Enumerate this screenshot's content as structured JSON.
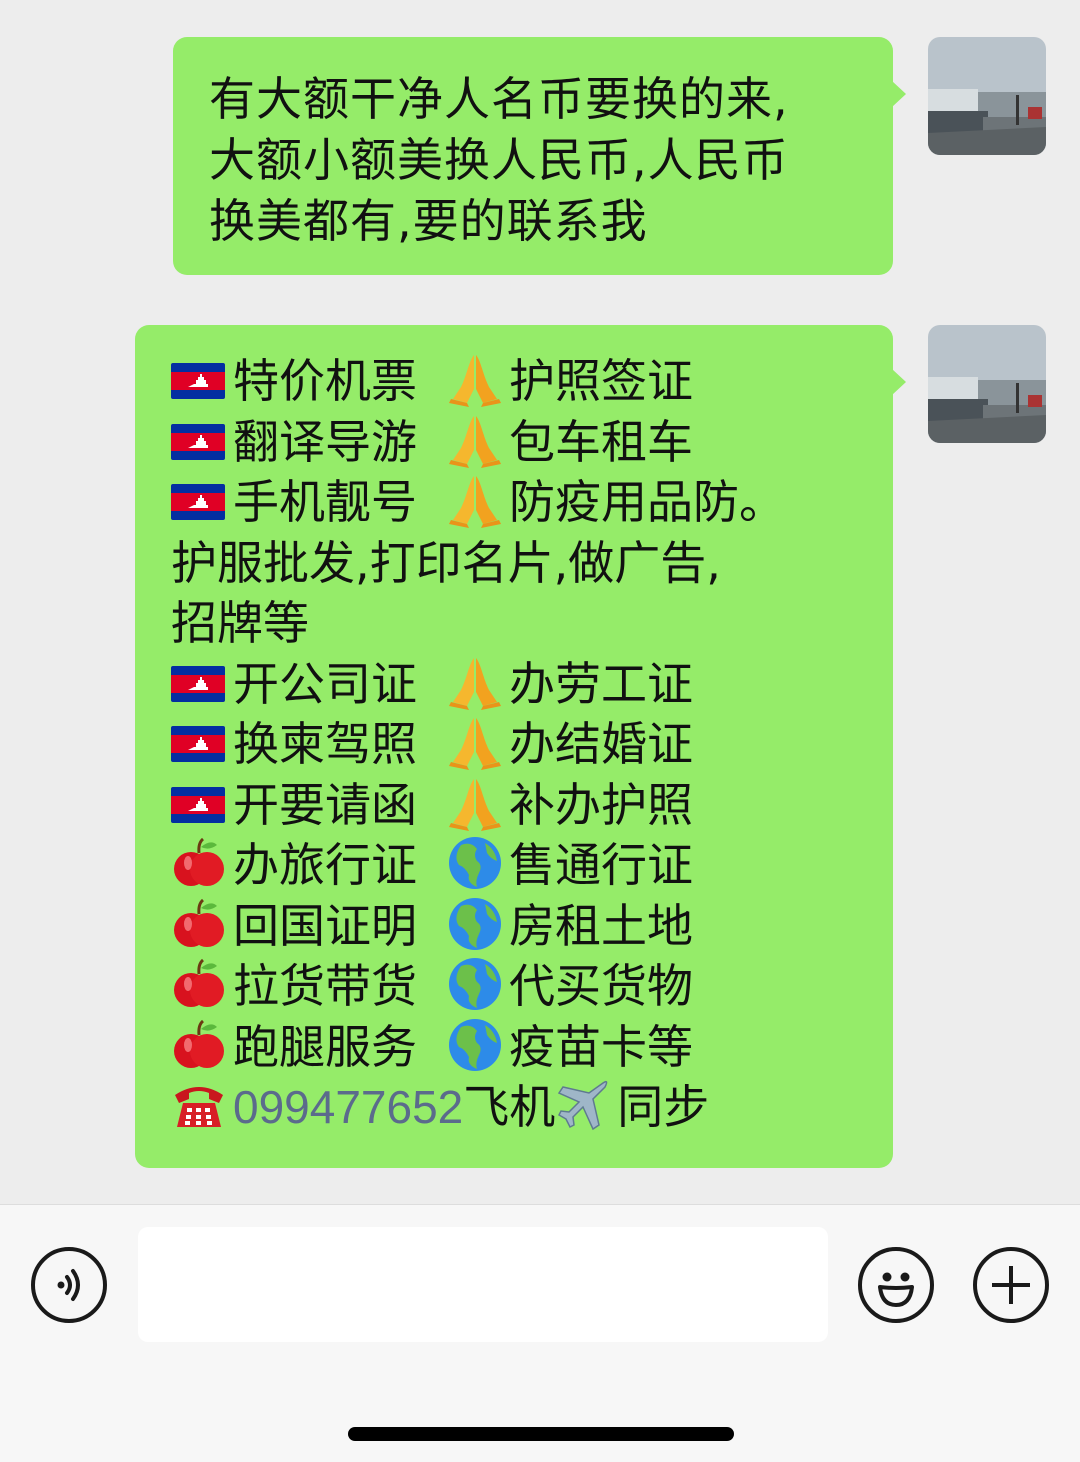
{
  "colors": {
    "bubble": "#95ec69",
    "background": "#ededed",
    "input_bar": "#f7f7f7",
    "phone_link": "#5b6b8c"
  },
  "messages": [
    {
      "sender": "self",
      "avatar": "harbor-boat-photo",
      "lines": [
        "有大额干净人名币要换的来,",
        "大额小额美换人民币,人民币",
        "换美都有,要的联系我"
      ]
    },
    {
      "sender": "self",
      "avatar": "harbor-boat-photo",
      "rows": [
        {
          "icon1": "cambodia-flag-icon",
          "text1": "特价机票",
          "icon2": "praying-hands-icon",
          "text2": "护照签证"
        },
        {
          "icon1": "cambodia-flag-icon",
          "text1": "翻译导游",
          "icon2": "praying-hands-icon",
          "text2": "包车租车"
        },
        {
          "icon1": "cambodia-flag-icon",
          "text1": "手机靓号",
          "icon2": "praying-hands-icon",
          "text2": "防疫用品防。"
        }
      ],
      "plain_lines": [
        "护服批发,打印名片,做广告,",
        "招牌等"
      ],
      "rows2": [
        {
          "icon1": "cambodia-flag-icon",
          "text1": "开公司证",
          "icon2": "praying-hands-icon",
          "text2": "办劳工证"
        },
        {
          "icon1": "cambodia-flag-icon",
          "text1": "换柬驾照",
          "icon2": "praying-hands-icon",
          "text2": "办结婚证"
        },
        {
          "icon1": "cambodia-flag-icon",
          "text1": "开要请函",
          "icon2": "praying-hands-icon",
          "text2": "补办护照"
        },
        {
          "icon1": "red-apple-icon",
          "text1": "办旅行证",
          "icon2": "globe-americas-icon",
          "text2": "售通行证"
        },
        {
          "icon1": "red-apple-icon",
          "text1": "回国证明",
          "icon2": "globe-americas-icon",
          "text2": "房租土地"
        },
        {
          "icon1": "red-apple-icon",
          "text1": "拉货带货",
          "icon2": "globe-americas-icon",
          "text2": "代买货物"
        },
        {
          "icon1": "red-apple-icon",
          "text1": "跑腿服务",
          "icon2": "globe-americas-icon",
          "text2": "疫苗卡等"
        }
      ],
      "contact": {
        "phone": "099477652",
        "after_phone": "飞机",
        "after_plane": "同步"
      }
    }
  ],
  "input_bar": {
    "voice_icon": "voice-icon",
    "input_value": "",
    "emoji_icon": "smiley-icon",
    "more_icon": "plus-icon"
  }
}
